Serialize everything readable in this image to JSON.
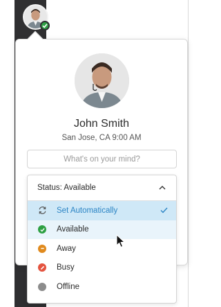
{
  "profile": {
    "name": "John Smith",
    "location_time": "San Jose, CA 9:00 AM"
  },
  "mind_input": {
    "placeholder": "What's on your mind?",
    "value": ""
  },
  "status_dropdown": {
    "header_label": "Status: Available",
    "options": [
      {
        "label": "Set Automatically",
        "icon": "sync-icon",
        "selected": true
      },
      {
        "label": "Available",
        "icon": "available-icon",
        "color": "#2ea043"
      },
      {
        "label": "Away",
        "icon": "away-icon",
        "color": "#e08a1e"
      },
      {
        "label": "Busy",
        "icon": "busy-icon",
        "color": "#e4533f"
      },
      {
        "label": "Offline",
        "icon": "offline-icon",
        "color": "#8c8c8c"
      }
    ]
  },
  "colors": {
    "accent": "#2b84c4",
    "selected_bg": "#cfe8f7",
    "sidebar": "#2f2f31",
    "presence": "#2ea043"
  }
}
